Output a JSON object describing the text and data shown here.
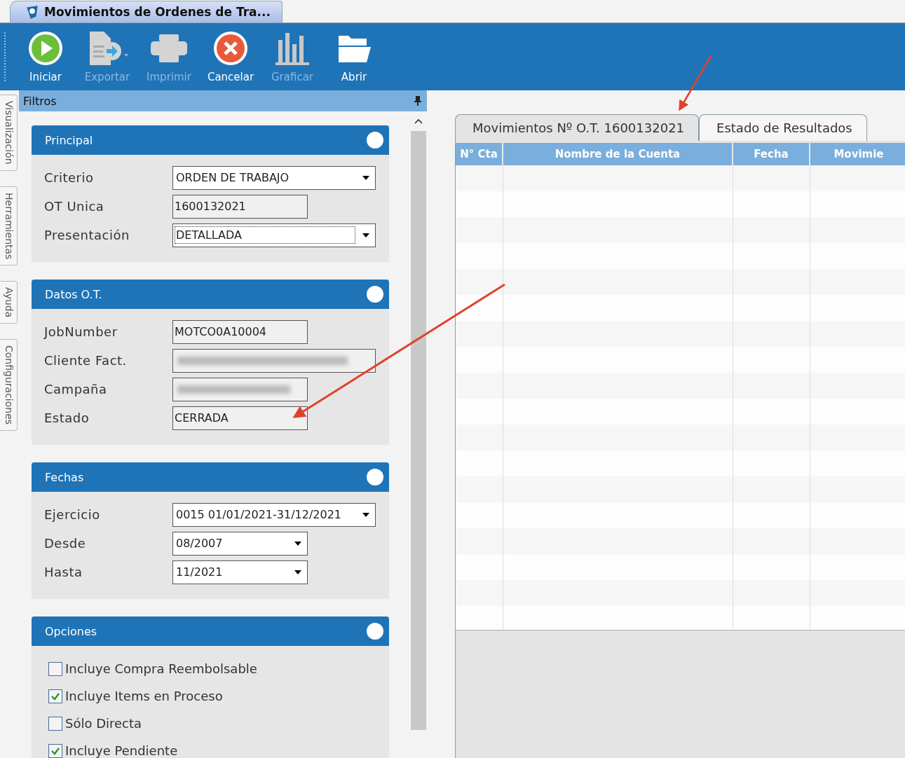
{
  "window": {
    "title": "Movimientos de Ordenes de Tra..."
  },
  "toolbar": [
    {
      "label": "Iniciar",
      "kind": "play",
      "disabled": false
    },
    {
      "label": "Exportar",
      "kind": "export",
      "disabled": true
    },
    {
      "label": "Imprimir",
      "kind": "print",
      "disabled": true
    },
    {
      "label": "Cancelar",
      "kind": "cancel",
      "disabled": false
    },
    {
      "label": "Graficar",
      "kind": "chart",
      "disabled": true
    },
    {
      "label": "Abrir",
      "kind": "folder",
      "disabled": false
    }
  ],
  "side_tabs": [
    "Visualización",
    "Herramientas",
    "Ayuda",
    "Configuraciones"
  ],
  "filters": {
    "title": "Filtros",
    "sections": [
      {
        "title": "Principal",
        "fields": [
          {
            "label": "Criterio",
            "kind": "select",
            "value": "ORDEN DE TRABAJO",
            "focused": false
          },
          {
            "label": "OT Unica",
            "kind": "input",
            "value": "1600132021"
          },
          {
            "label": "Presentación",
            "kind": "select",
            "value": "DETALLADA",
            "focused": true
          }
        ]
      },
      {
        "title": "Datos O.T.",
        "fields": [
          {
            "label": "JobNumber",
            "kind": "input",
            "value": "MOTCO0A10004"
          },
          {
            "label": "Cliente Fact.",
            "kind": "blurred"
          },
          {
            "label": "Campaña",
            "kind": "blurred"
          },
          {
            "label": "Estado",
            "kind": "input",
            "value": "CERRADA"
          }
        ]
      },
      {
        "title": "Fechas",
        "fields": [
          {
            "label": "Ejercicio",
            "kind": "select",
            "value": "0015 01/01/2021-31/12/2021",
            "focused": false
          },
          {
            "label": "Desde",
            "kind": "select",
            "value": "08/2007",
            "focused": false
          },
          {
            "label": "Hasta",
            "kind": "select",
            "value": "11/2021",
            "focused": false
          }
        ]
      },
      {
        "title": "Opciones",
        "options": [
          {
            "label": "Incluye Compra Reembolsable",
            "checked": false
          },
          {
            "label": "Incluye Items en Proceso",
            "checked": true
          },
          {
            "label": "Sólo Directa",
            "checked": false
          },
          {
            "label": "Incluye Pendiente",
            "checked": true
          }
        ]
      }
    ]
  },
  "result_tabs": [
    {
      "label": "Movimientos Nº O.T. 1600132021",
      "selected": true
    },
    {
      "label": "Estado de Resultados",
      "selected": false
    }
  ],
  "table": {
    "columns": [
      "N° Cta",
      "Nombre de la Cuenta",
      "Fecha",
      "Movimie"
    ]
  }
}
